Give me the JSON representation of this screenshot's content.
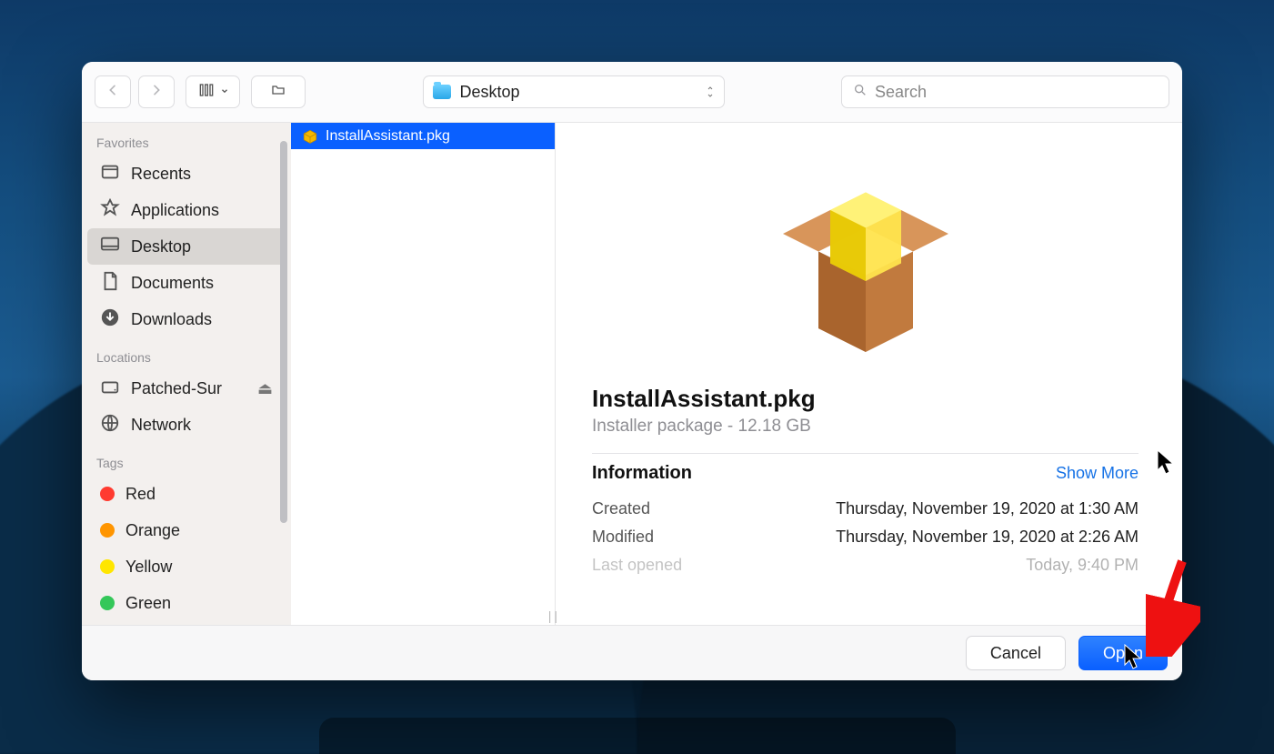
{
  "toolbar": {
    "location_label": "Desktop",
    "search_placeholder": "Search"
  },
  "sidebar": {
    "sections": {
      "favorites": "Favorites",
      "locations": "Locations",
      "tags": "Tags"
    },
    "favorites": [
      "Recents",
      "Applications",
      "Desktop",
      "Documents",
      "Downloads"
    ],
    "locations": [
      "Patched-Sur",
      "Network"
    ],
    "tags": [
      {
        "label": "Red",
        "color": "#ff3b30"
      },
      {
        "label": "Orange",
        "color": "#ff9500"
      },
      {
        "label": "Yellow",
        "color": "#ffcc00"
      },
      {
        "label": "Green",
        "color": "#34c759"
      }
    ]
  },
  "filelist": {
    "selected": "InstallAssistant.pkg"
  },
  "preview": {
    "name": "InstallAssistant.pkg",
    "subtitle": "Installer package - 12.18 GB",
    "info_heading": "Information",
    "show_more": "Show More",
    "rows": [
      {
        "k": "Created",
        "v": "Thursday, November 19, 2020 at 1:30 AM"
      },
      {
        "k": "Modified",
        "v": "Thursday, November 19, 2020 at 2:26 AM"
      },
      {
        "k": "Last opened",
        "v": "Today, 9:40 PM"
      }
    ]
  },
  "footer": {
    "cancel": "Cancel",
    "open": "Open"
  }
}
